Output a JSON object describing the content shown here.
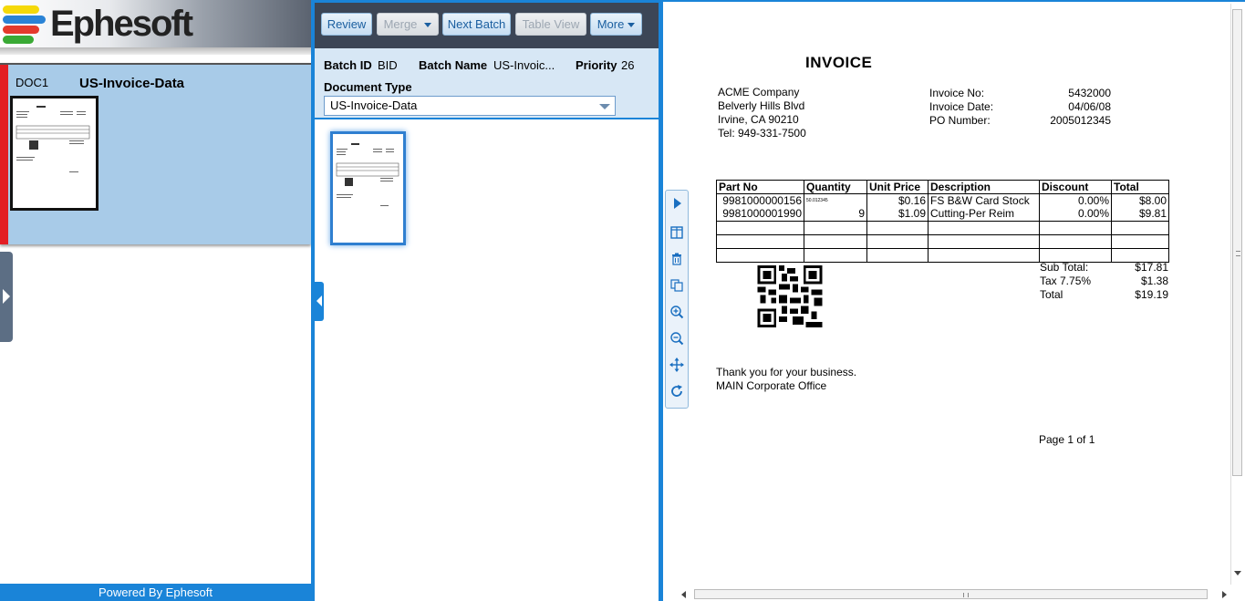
{
  "brand": {
    "logo_text": "Ephesoft",
    "powered_by": "Powered By Ephesoft"
  },
  "document_list": {
    "doc_id": "DOC1",
    "doc_type": "US-Invoice-Data"
  },
  "toolbar": {
    "review": "Review",
    "merge": "Merge",
    "next_batch": "Next Batch",
    "table_view": "Table View",
    "more": "More"
  },
  "batch": {
    "id_label": "Batch ID",
    "id_value": "BID",
    "name_label": "Batch Name",
    "name_value": "US-Invoic...",
    "priority_label": "Priority",
    "priority_value": "26",
    "doc_type_label": "Document Type",
    "doc_type_value": "US-Invoice-Data"
  },
  "invoice": {
    "title": "INVOICE",
    "company": [
      "ACME Company",
      "Belverly Hills Blvd",
      "Irvine, CA 90210",
      "Tel: 949-331-7500"
    ],
    "meta_labels": [
      "Invoice No:",
      "Invoice Date:",
      "PO Number:"
    ],
    "meta_values": [
      "5432000",
      "04/06/08",
      "2005012345"
    ],
    "table": {
      "headers": [
        "Part No",
        "Quantity",
        "Unit Price",
        "Description",
        "Discount",
        "Total"
      ],
      "rows": [
        [
          "9981000000156",
          "50.012345",
          "$0.16",
          "FS B&W Card Stock",
          "0.00%",
          "$8.00"
        ],
        [
          "9981000001990",
          "9",
          "$1.09",
          "Cutting-Per Reim",
          "0.00%",
          "$9.81"
        ]
      ]
    },
    "totals_labels": [
      "Sub Total:",
      "Tax 7.75%",
      "Total"
    ],
    "totals_values": [
      "$17.81",
      "$1.38",
      "$19.19"
    ],
    "footer": [
      "Thank you for your business.",
      "MAIN Corporate Office"
    ],
    "page": "Page 1 of 1"
  },
  "colors": {
    "accent": "#1a84d8",
    "card": "#a8cbe8",
    "flag": "#e31e24",
    "toolbar": "#3c4656"
  },
  "icons": [
    "play-icon",
    "split-icon",
    "trash-icon",
    "copy-icon",
    "zoom-in-icon",
    "zoom-out-icon",
    "move-icon",
    "rotate-icon"
  ]
}
